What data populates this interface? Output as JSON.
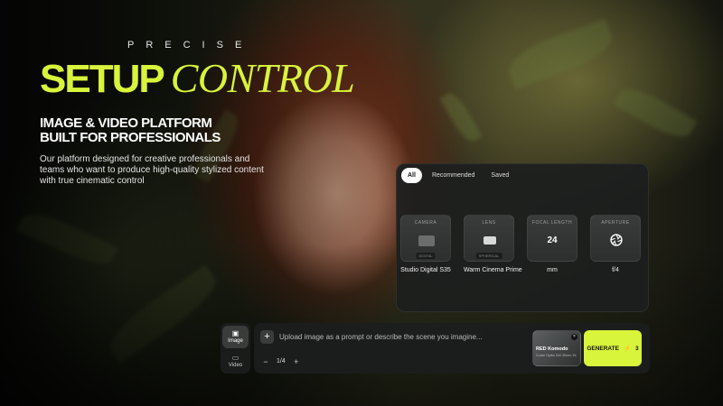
{
  "hero": {
    "eyebrow": "PRECISE",
    "headline_part1": "SETUP",
    "headline_part2": "CONTROL",
    "subhead_line1": "IMAGE & VIDEO PLATFORM",
    "subhead_line2": "BUILT FOR PROFESSIONALS",
    "description": "Our platform designed for creative professionals and teams who want to produce high-quality stylized content with true cinematic control",
    "accent_color": "#d8f43b"
  },
  "setup_panel": {
    "tabs": [
      {
        "label": "All",
        "active": true
      },
      {
        "label": "Recommended",
        "active": false
      },
      {
        "label": "Saved",
        "active": false
      }
    ],
    "cards": [
      {
        "category": "CAMERA",
        "tag": "DIGITAL",
        "name": "Studio Digital S35",
        "icon": "camera-icon"
      },
      {
        "category": "LENS",
        "tag": "SPHERICAL",
        "name": "Warm Cinema Prime",
        "icon": "lens-icon"
      },
      {
        "category": "FOCAL LENGTH",
        "value": "24",
        "name": "mm"
      },
      {
        "category": "APERTURE",
        "name": "f/4",
        "icon": "aperture-icon"
      }
    ]
  },
  "mode_switch": {
    "items": [
      {
        "label": "Image",
        "icon": "image-icon",
        "active": true
      },
      {
        "label": "Video",
        "icon": "video-icon",
        "active": false
      }
    ]
  },
  "prompt_bar": {
    "placeholder": "Upload image as a prompt or describe the scene you imagine...",
    "count": "1/4",
    "minus": "−",
    "plus": "+",
    "camera_card": {
      "title": "RED Komodo",
      "details": "Cooke Optics S4/i 35mm, f/4"
    },
    "generate_label": "GENERATE",
    "credits": "3"
  }
}
